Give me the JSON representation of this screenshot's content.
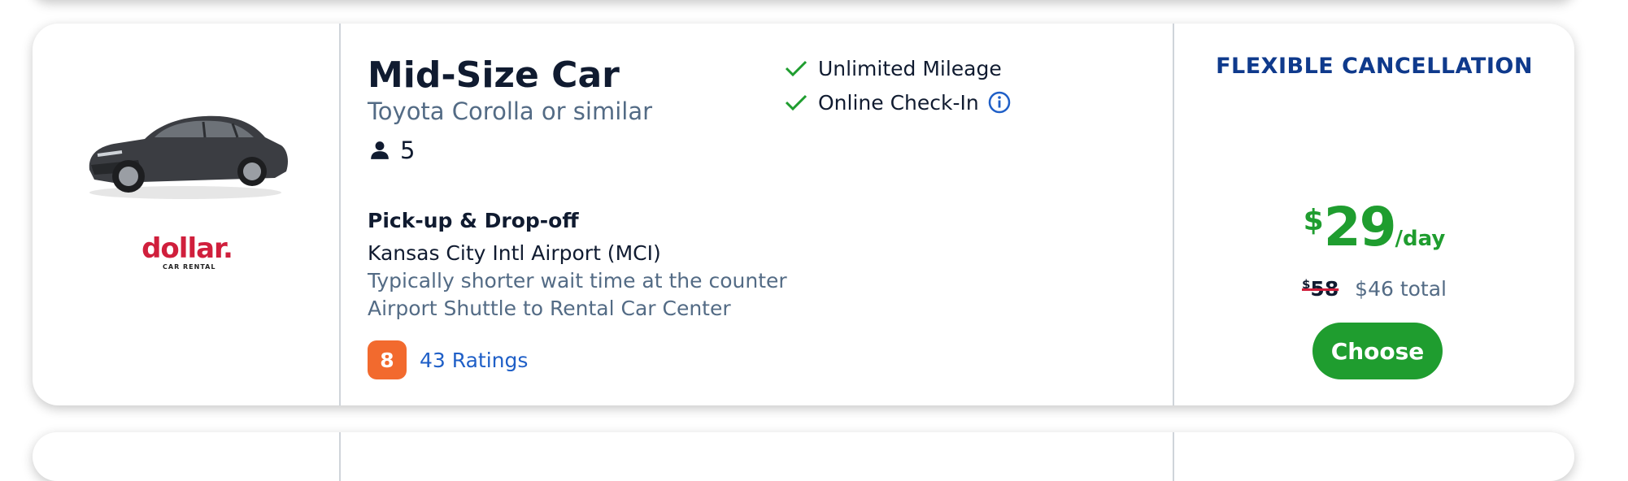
{
  "vehicle": {
    "class_name": "Mid-Size Car",
    "model": "Toyota Corolla or similar",
    "seats": "5",
    "image_icon": "car-photo"
  },
  "vendor": {
    "name": "dollar.",
    "subtext": "CAR RENTAL",
    "brand_color": "#d01f3c"
  },
  "features": [
    {
      "label": "Unlimited Mileage",
      "icon": "check-icon"
    },
    {
      "label": "Online Check-In",
      "icon": "check-icon",
      "info": "info-icon"
    }
  ],
  "pickup": {
    "title": "Pick-up & Drop-off",
    "location": "Kansas City Intl Airport (MCI)",
    "wait_note": "Typically shorter wait time at the counter",
    "shuttle_note": "Airport Shuttle to Rental Car Center"
  },
  "rating": {
    "score": "8",
    "count_label": "43 Ratings",
    "badge_color": "#f26a2e"
  },
  "pricing": {
    "cancellation": "FLEXIBLE CANCELLATION",
    "currency": "$",
    "daily_amount": "29",
    "per_label": "/day",
    "old_currency": "$",
    "old_price": "58",
    "total_label": "$46 total",
    "choose_label": "Choose",
    "accent_color": "#1f9d2f"
  }
}
